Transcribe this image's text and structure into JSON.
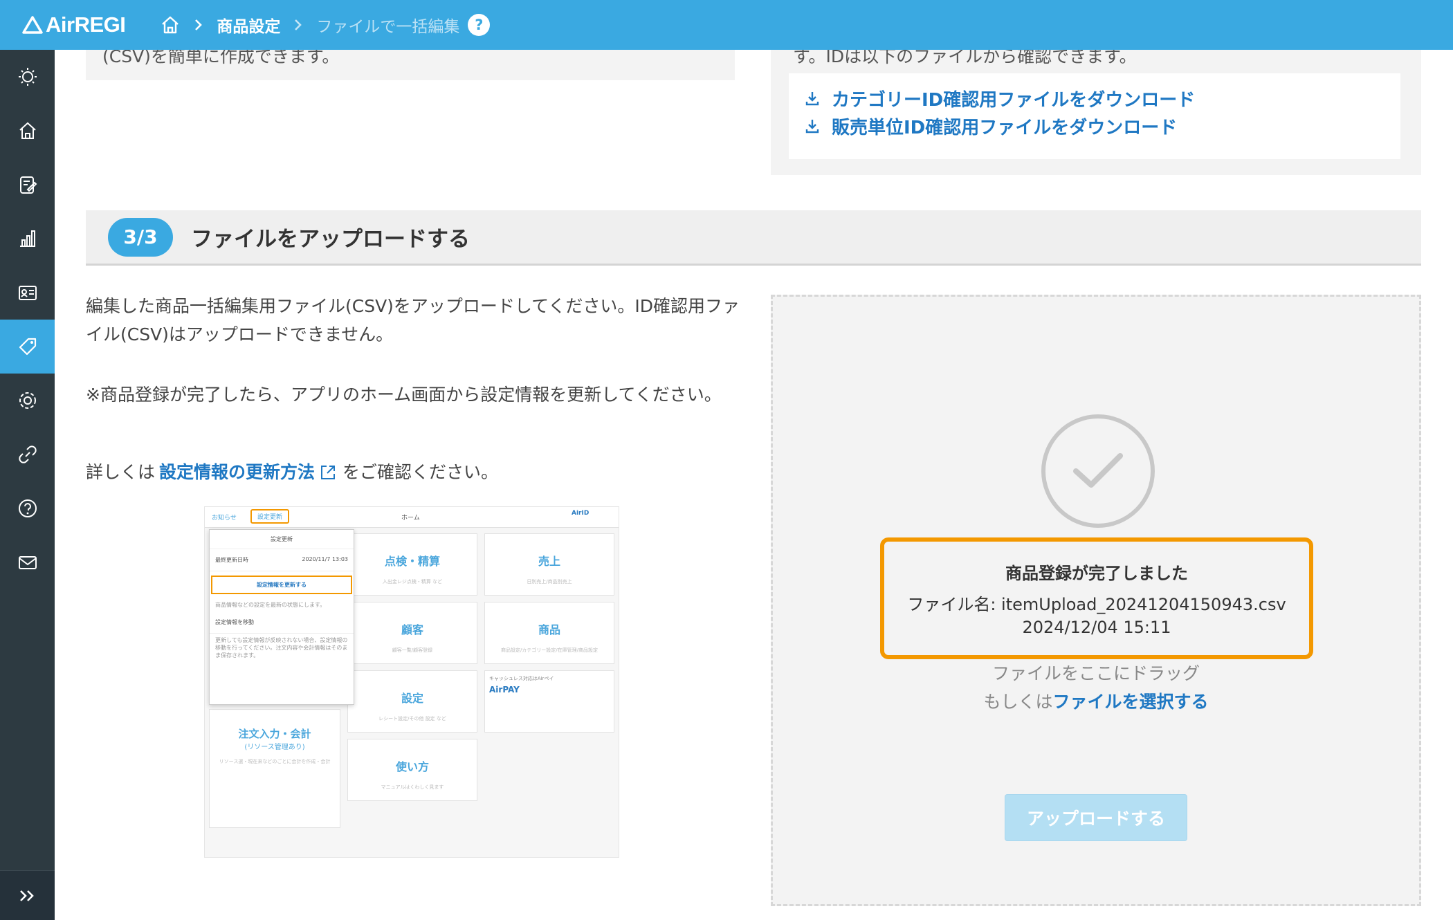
{
  "header": {
    "logo_text": "AirREGI",
    "breadcrumb": {
      "parent": "商品設定",
      "current": "ファイルで一括編集"
    },
    "help_glyph": "?"
  },
  "sidebar": {
    "items": [
      {
        "icon": "lightbulb-icon"
      },
      {
        "icon": "home-icon"
      },
      {
        "icon": "clipboard-edit-icon"
      },
      {
        "icon": "bar-chart-icon"
      },
      {
        "icon": "customer-card-icon"
      },
      {
        "icon": "tag-icon",
        "active": true
      },
      {
        "icon": "gear-icon"
      },
      {
        "icon": "link-icon"
      },
      {
        "icon": "help-icon"
      },
      {
        "icon": "mail-icon"
      }
    ],
    "expand_glyph": "»"
  },
  "top_left_box": {
    "cut_text": "(CSV)を簡単に作成できます。"
  },
  "top_right_box": {
    "cut_text": "す。IDは以下のファイルから確認できます。",
    "links": [
      "カテゴリーID確認用ファイルをダウンロード",
      "販売単位ID確認用ファイルをダウンロード"
    ]
  },
  "step": {
    "badge": "3/3",
    "title": "ファイルをアップロードする"
  },
  "instructions": {
    "desc": "編集した商品一括編集用ファイル(CSV)をアップロードしてください。ID確認用ファイル(CSV)はアップロードできません。",
    "note": "※商品登録が完了したら、アプリのホーム画面から設定情報を更新してください。",
    "detail_prefix": "詳しくは",
    "detail_link": "設定情報の更新方法",
    "detail_suffix": "をご確認ください。"
  },
  "thumbnail": {
    "tab_notice": "お知らせ",
    "tab_update": "設定更新",
    "home": "ホーム",
    "air_id": "AirID",
    "popup_title": "設定更新",
    "popup_row_label": "最終更新日時",
    "popup_row_value": "2020/11/7 13:03",
    "popup_button": "設定情報を更新する",
    "popup_text": "商品情報などの設定を最新の状態にします。",
    "popup_row2": "設定情報を移動",
    "popup_text2": "更新しても設定情報が反映されない場合、設定情報の移動を行ってください。注文内容や会計情報はそのまま保存されます。",
    "cards": [
      {
        "label": "点検・精算",
        "sub": "入出金レジ点検・精算 など"
      },
      {
        "label": "売上",
        "sub": "日別売上/商品別売上"
      },
      {
        "label": "顧客",
        "sub": "顧客一覧/顧客登録"
      },
      {
        "label": "商品",
        "sub": "商品設定/カテゴリー設定/在庫管理/商品設定"
      },
      {
        "label": "設定",
        "sub": "レシート設定/その他 設定 など"
      },
      {
        "label": "使い方",
        "sub": "マニュアルはくわしく見ます"
      }
    ],
    "order_label": "注文入力・会計",
    "order_sub": "(リソース管理あり)",
    "order_sub2": "リソース選・現在来などのごとに会計を作成・会計",
    "airpay_top": "キャッシュレス対応はAirペイ",
    "airpay": "AirPAY"
  },
  "upload": {
    "result_title": "商品登録が完了しました",
    "file_label": "ファイル名: itemUpload_20241204150943.csv",
    "date": "2024/12/04 15:11",
    "drag_text": "ファイルをここにドラッグ",
    "or_text": "もしくは",
    "select_link": "ファイルを選択する",
    "upload_button": "アップロードする"
  },
  "colors": {
    "brand": "#3aa9e1",
    "link": "#1f78c3",
    "highlight": "#f39800",
    "sidebar": "#2d3a41"
  }
}
